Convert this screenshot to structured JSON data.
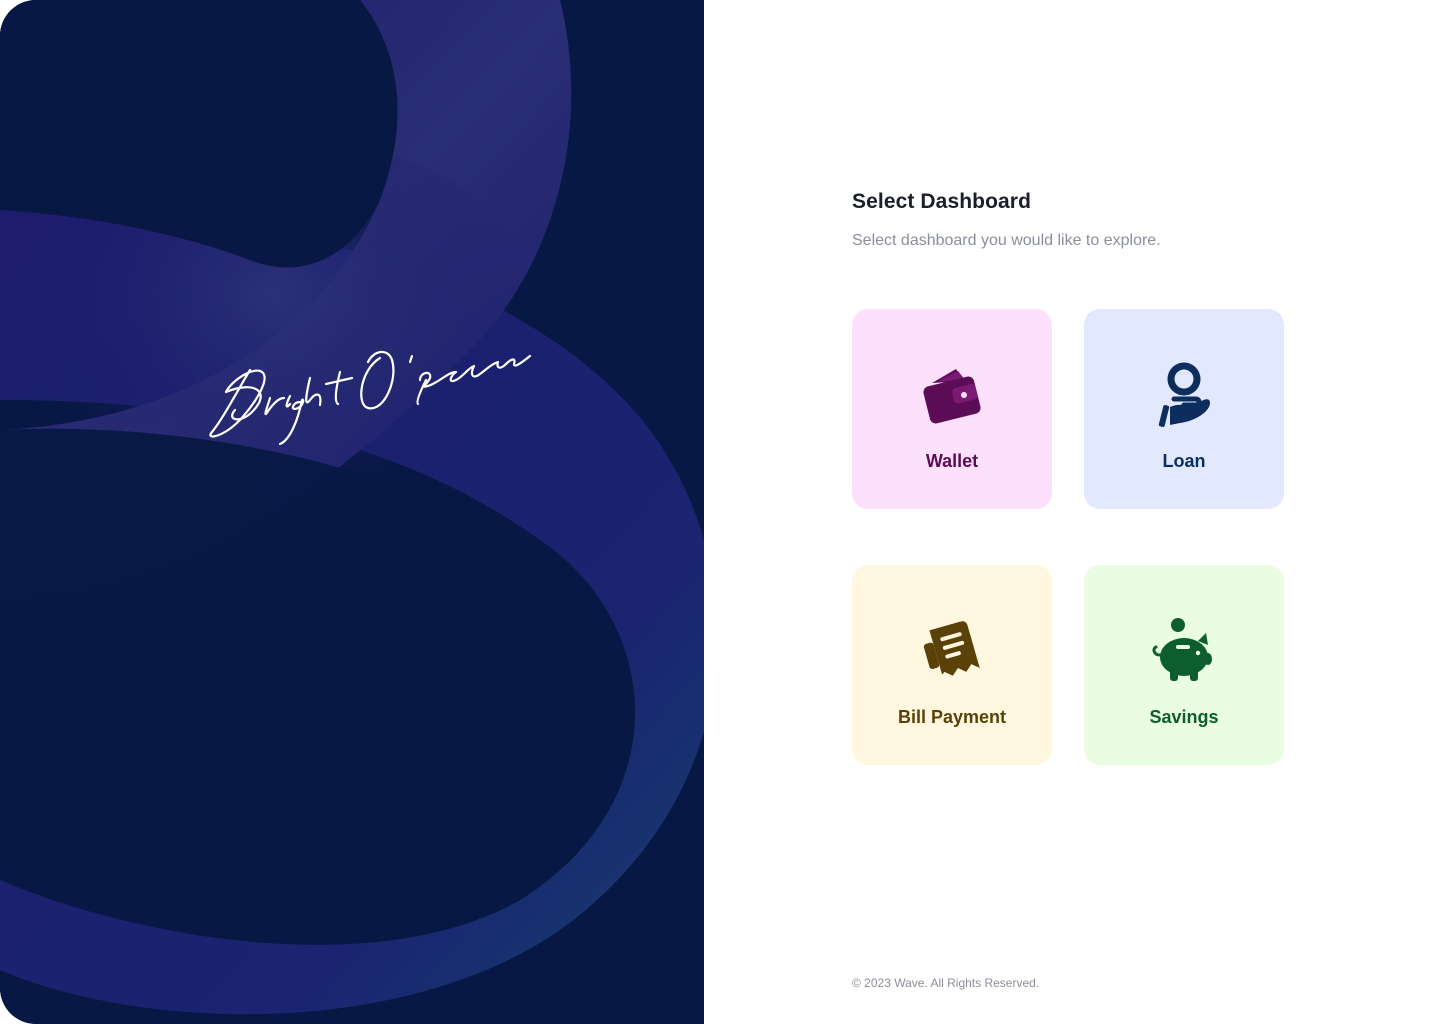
{
  "hero": {
    "signature": "Bright O'feranmi"
  },
  "main": {
    "title": "Select Dashboard",
    "subtitle": "Select dashboard you would like to explore.",
    "cards": [
      {
        "label": "Wallet",
        "icon": "wallet-icon",
        "bg": "#fde0fb",
        "color": "#5c0b55"
      },
      {
        "label": "Loan",
        "icon": "loan-hand-coin-icon",
        "bg": "#e2e9fe",
        "color": "#0d2d5c"
      },
      {
        "label": "Bill Payment",
        "icon": "bill-receipt-icon",
        "bg": "#fff7e0",
        "color": "#5a4107"
      },
      {
        "label": "Savings",
        "icon": "piggy-bank-icon",
        "bg": "#eafde2",
        "color": "#0d5e2c"
      }
    ]
  },
  "footer": {
    "copyright": "© 2023 Wave. All Rights Reserved."
  },
  "colors": {
    "hero_bg": "#061843",
    "hero_ribbon": "#1c1b6e"
  }
}
